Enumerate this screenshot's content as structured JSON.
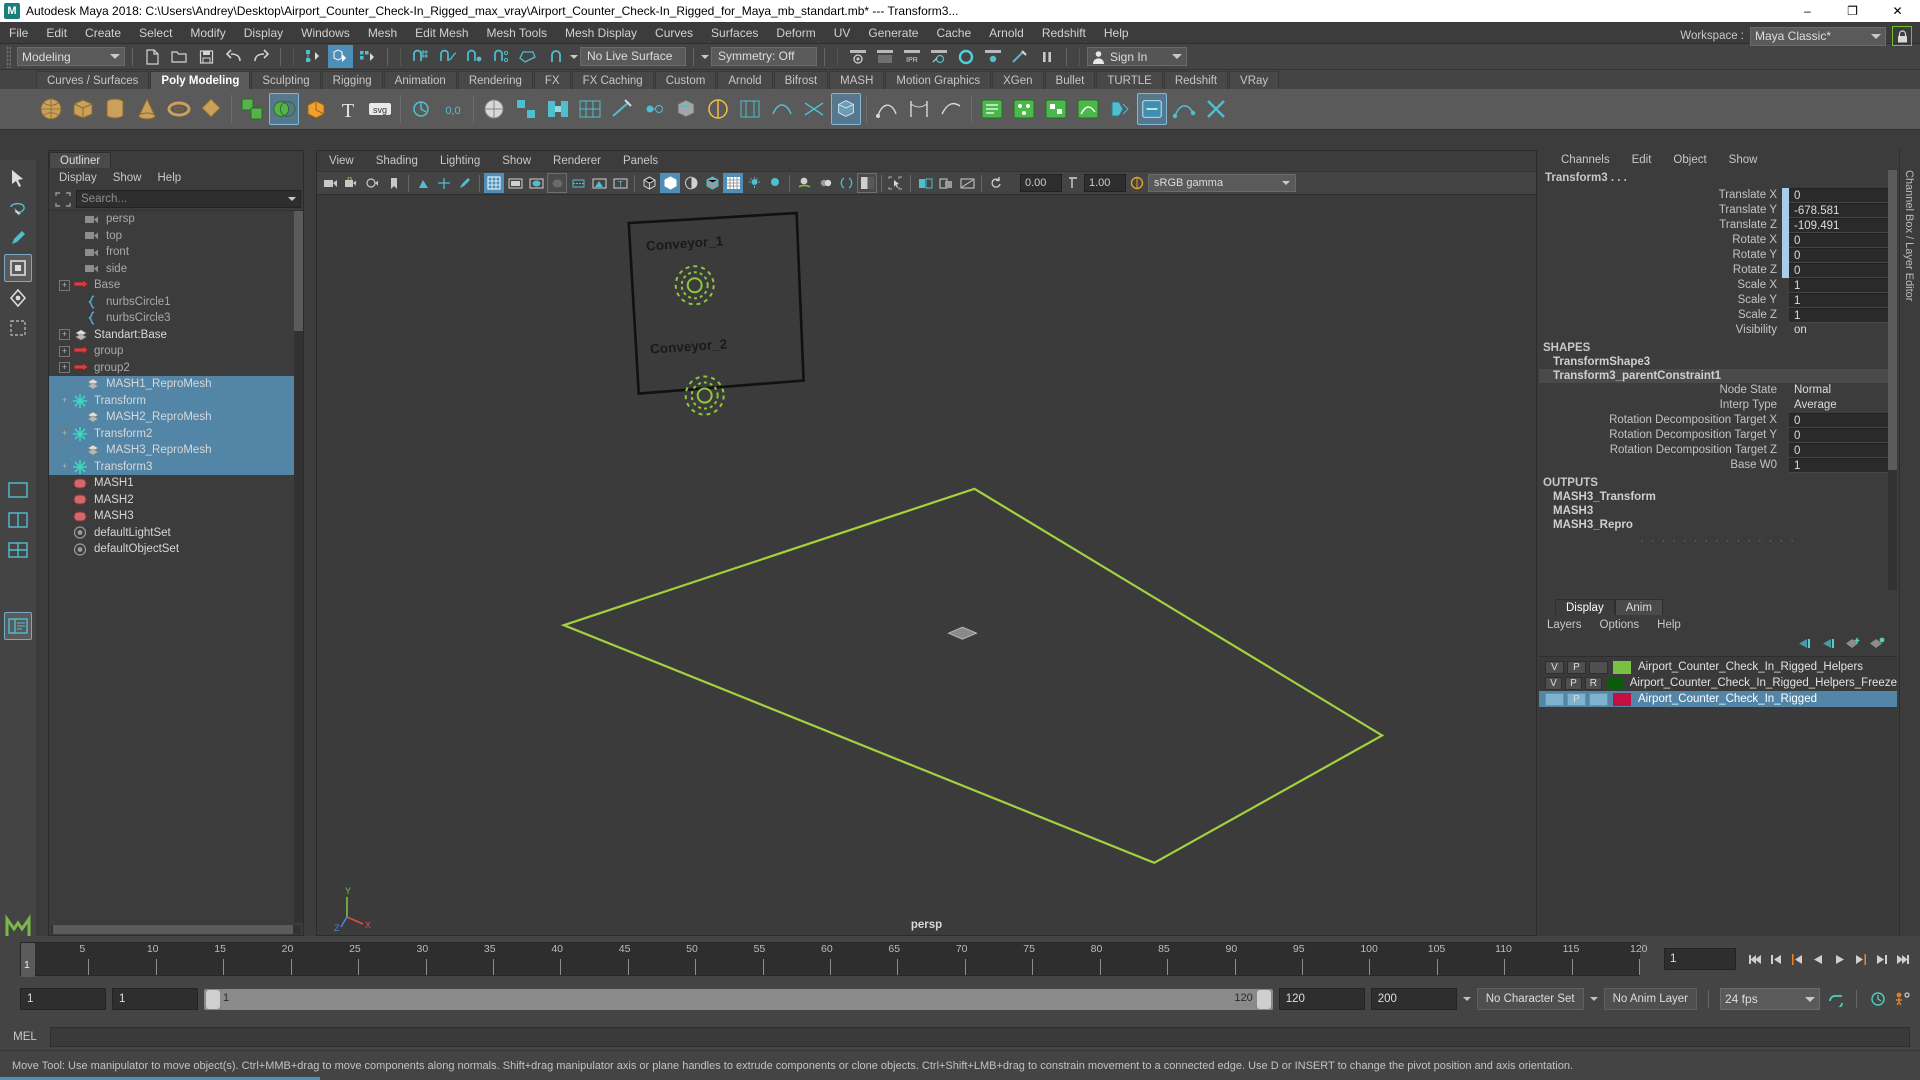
{
  "window": {
    "title": "Autodesk Maya 2018: C:\\Users\\Andrey\\Desktop\\Airport_Counter_Check-In_Rigged_max_vray\\Airport_Counter_Check-In_Rigged_for_Maya_mb_standart.mb*  ---  Transform3...",
    "logo": "M",
    "minimize": "–",
    "maximize": "❐",
    "close": "✕"
  },
  "menubar": {
    "items": [
      "File",
      "Edit",
      "Create",
      "Select",
      "Modify",
      "Display",
      "Windows",
      "Mesh",
      "Edit Mesh",
      "Mesh Tools",
      "Mesh Display",
      "Curves",
      "Surfaces",
      "Deform",
      "UV",
      "Generate",
      "Cache",
      "Arnold",
      "Redshift",
      "Help"
    ]
  },
  "statusline": {
    "menuset": "Modeling",
    "live_surface": "No Live Surface",
    "symmetry": "Symmetry: Off",
    "signin": "Sign In",
    "workspace_label": "Workspace :",
    "workspace_value": "Maya Classic*"
  },
  "shelf": {
    "tabs": [
      {
        "label": "Curves / Surfaces",
        "active": false
      },
      {
        "label": "Poly Modeling",
        "active": true
      },
      {
        "label": "Sculpting",
        "active": false
      },
      {
        "label": "Rigging",
        "active": false
      },
      {
        "label": "Animation",
        "active": false
      },
      {
        "label": "Rendering",
        "active": false
      },
      {
        "label": "FX",
        "active": false
      },
      {
        "label": "FX Caching",
        "active": false
      },
      {
        "label": "Custom",
        "active": false
      },
      {
        "label": "Arnold",
        "active": false
      },
      {
        "label": "Bifrost",
        "active": false
      },
      {
        "label": "MASH",
        "active": false
      },
      {
        "label": "Motion Graphics",
        "active": false
      },
      {
        "label": "XGen",
        "active": false
      },
      {
        "label": "Bullet",
        "active": false
      },
      {
        "label": "TURTLE",
        "active": false
      },
      {
        "label": "Redshift",
        "active": false
      },
      {
        "label": "VRay",
        "active": false
      }
    ]
  },
  "outliner": {
    "tab": "Outliner",
    "menu": [
      "Display",
      "Show",
      "Help"
    ],
    "search_placeholder": "Search...",
    "items": [
      {
        "label": "persp",
        "icon": "camera-icon",
        "expandable": false,
        "selected": false,
        "dim": true
      },
      {
        "label": "top",
        "icon": "camera-icon",
        "expandable": false,
        "selected": false,
        "dim": true
      },
      {
        "label": "front",
        "icon": "camera-icon",
        "expandable": false,
        "selected": false,
        "dim": true
      },
      {
        "label": "side",
        "icon": "camera-icon",
        "expandable": false,
        "selected": false,
        "dim": true
      },
      {
        "label": "Base",
        "icon": "transform-icon",
        "expandable": true,
        "selected": false,
        "dim": true
      },
      {
        "label": "nurbsCircle1",
        "icon": "curve-icon",
        "expandable": false,
        "selected": false,
        "dim": true
      },
      {
        "label": "nurbsCircle3",
        "icon": "curve-icon",
        "expandable": false,
        "selected": false,
        "dim": true
      },
      {
        "label": "Standart:Base",
        "icon": "mesh-icon",
        "expandable": true,
        "selected": false,
        "dim": false
      },
      {
        "label": "group",
        "icon": "transform-icon",
        "expandable": true,
        "selected": false,
        "dim": true
      },
      {
        "label": "group2",
        "icon": "transform-icon",
        "expandable": true,
        "selected": false,
        "dim": true
      },
      {
        "label": "MASH1_ReproMesh",
        "icon": "mesh-icon",
        "expandable": false,
        "selected": true,
        "dim": false
      },
      {
        "label": "Transform",
        "icon": "mash-icon",
        "expandable": true,
        "selected": true,
        "dim": false
      },
      {
        "label": "MASH2_ReproMesh",
        "icon": "mesh-icon",
        "expandable": false,
        "selected": true,
        "dim": false
      },
      {
        "label": "Transform2",
        "icon": "mash-icon",
        "expandable": true,
        "selected": true,
        "dim": false
      },
      {
        "label": "MASH3_ReproMesh",
        "icon": "mesh-icon",
        "expandable": false,
        "selected": true,
        "dim": false
      },
      {
        "label": "Transform3",
        "icon": "mash-icon",
        "expandable": true,
        "selected": true,
        "dim": false
      },
      {
        "label": "MASH1",
        "icon": "network-icon",
        "expandable": false,
        "selected": false,
        "dim": false
      },
      {
        "label": "MASH2",
        "icon": "network-icon",
        "expandable": false,
        "selected": false,
        "dim": false
      },
      {
        "label": "MASH3",
        "icon": "network-icon",
        "expandable": false,
        "selected": false,
        "dim": false
      },
      {
        "label": "defaultLightSet",
        "icon": "set-icon",
        "expandable": false,
        "selected": false,
        "dim": false
      },
      {
        "label": "defaultObjectSet",
        "icon": "set-icon",
        "expandable": false,
        "selected": false,
        "dim": false
      }
    ]
  },
  "viewport": {
    "menu": [
      "View",
      "Shading",
      "Lighting",
      "Show",
      "Renderer",
      "Panels"
    ],
    "exposure": "0.00",
    "gamma_value": "1.00",
    "color_management": "sRGB gamma",
    "camera_label": "persp",
    "annotations": [
      "Conveyor_1",
      "Conveyor_2"
    ],
    "axis_labels": {
      "y": "Y",
      "x": "X",
      "z": "Z"
    }
  },
  "channelbox": {
    "menu": [
      "Channels",
      "Edit",
      "Object",
      "Show"
    ],
    "node_title": "Transform3 . . .",
    "attributes": [
      {
        "label": "Translate X",
        "value": "0",
        "keyable": true
      },
      {
        "label": "Translate Y",
        "value": "-678.581",
        "keyable": true
      },
      {
        "label": "Translate Z",
        "value": "-109.491",
        "keyable": true
      },
      {
        "label": "Rotate X",
        "value": "0",
        "keyable": true
      },
      {
        "label": "Rotate Y",
        "value": "0",
        "keyable": true
      },
      {
        "label": "Rotate Z",
        "value": "0",
        "keyable": true
      },
      {
        "label": "Scale X",
        "value": "1",
        "keyable": false
      },
      {
        "label": "Scale Y",
        "value": "1",
        "keyable": false
      },
      {
        "label": "Scale Z",
        "value": "1",
        "keyable": false
      },
      {
        "label": "Visibility",
        "value": "on",
        "keyable": false,
        "plain": true
      }
    ],
    "shapes_header": "SHAPES",
    "shapes": [
      {
        "name": "TransformShape3",
        "highlighted": false
      },
      {
        "name": "Transform3_parentConstraint1",
        "highlighted": true
      }
    ],
    "constraint_attributes": [
      {
        "label": "Node State",
        "value": "Normal",
        "plain": true
      },
      {
        "label": "Interp Type",
        "value": "Average",
        "plain": true
      },
      {
        "label": "Rotation Decomposition Target X",
        "value": "0",
        "plain": false
      },
      {
        "label": "Rotation Decomposition Target Y",
        "value": "0",
        "plain": false
      },
      {
        "label": "Rotation Decomposition Target Z",
        "value": "0",
        "plain": false
      },
      {
        "label": "Base W0",
        "value": "1",
        "plain": false
      }
    ],
    "outputs_header": "OUTPUTS",
    "outputs": [
      "MASH3_Transform",
      "MASH3",
      "MASH3_Repro"
    ]
  },
  "layereditor": {
    "tabs": [
      {
        "label": "Display",
        "active": true
      },
      {
        "label": "Anim",
        "active": false
      }
    ],
    "menu": [
      "Layers",
      "Options",
      "Help"
    ],
    "layers": [
      {
        "visibility": "V",
        "playback": "P",
        "third": "",
        "color": "#7ac143",
        "name": "Airport_Counter_Check_In_Rigged_Helpers",
        "selected": false
      },
      {
        "visibility": "V",
        "playback": "P",
        "third": "R",
        "color": "#0a5c0a",
        "name": "Airport_Counter_Check_In_Rigged_Helpers_Freeze",
        "selected": false
      },
      {
        "visibility": "",
        "playback": "P",
        "third": "",
        "color": "#c31040",
        "name": "Airport_Counter_Check_In_Rigged",
        "selected": true
      }
    ]
  },
  "rightstrip": {
    "label": "Channel Box / Layer Editor"
  },
  "timeslider": {
    "ticks": [
      "5",
      "10",
      "15",
      "20",
      "25",
      "30",
      "35",
      "40",
      "45",
      "50",
      "55",
      "60",
      "65",
      "70",
      "75",
      "80",
      "85",
      "90",
      "95",
      "100",
      "105",
      "110",
      "115",
      "120"
    ],
    "current_frame": "1",
    "current_frame_field": "1"
  },
  "playbackrange": {
    "start_field": "1",
    "range_start_field": "1",
    "bar_start_label": "1",
    "bar_end_label": "120",
    "range_end_field": "120",
    "anim_end_field": "200",
    "character_set": "No Character Set",
    "anim_layer": "No Anim Layer",
    "fps": "24 fps"
  },
  "mel": {
    "label": "MEL",
    "value": ""
  },
  "helpline": {
    "text": "Move Tool: Use manipulator to move object(s). Ctrl+MMB+drag to move components along normals. Shift+drag manipulator axis or plane handles to extrude components or clone objects. Ctrl+Shift+LMB+drag to constrain movement to a connected edge. Use D or INSERT to change the pivot position and axis orientation."
  },
  "colors": {
    "selection_blue": "#5285a6",
    "accent_teal": "#4d8fb8",
    "viewport_green": "#9ecb3c",
    "mash_teal": "#3fd6c0"
  }
}
